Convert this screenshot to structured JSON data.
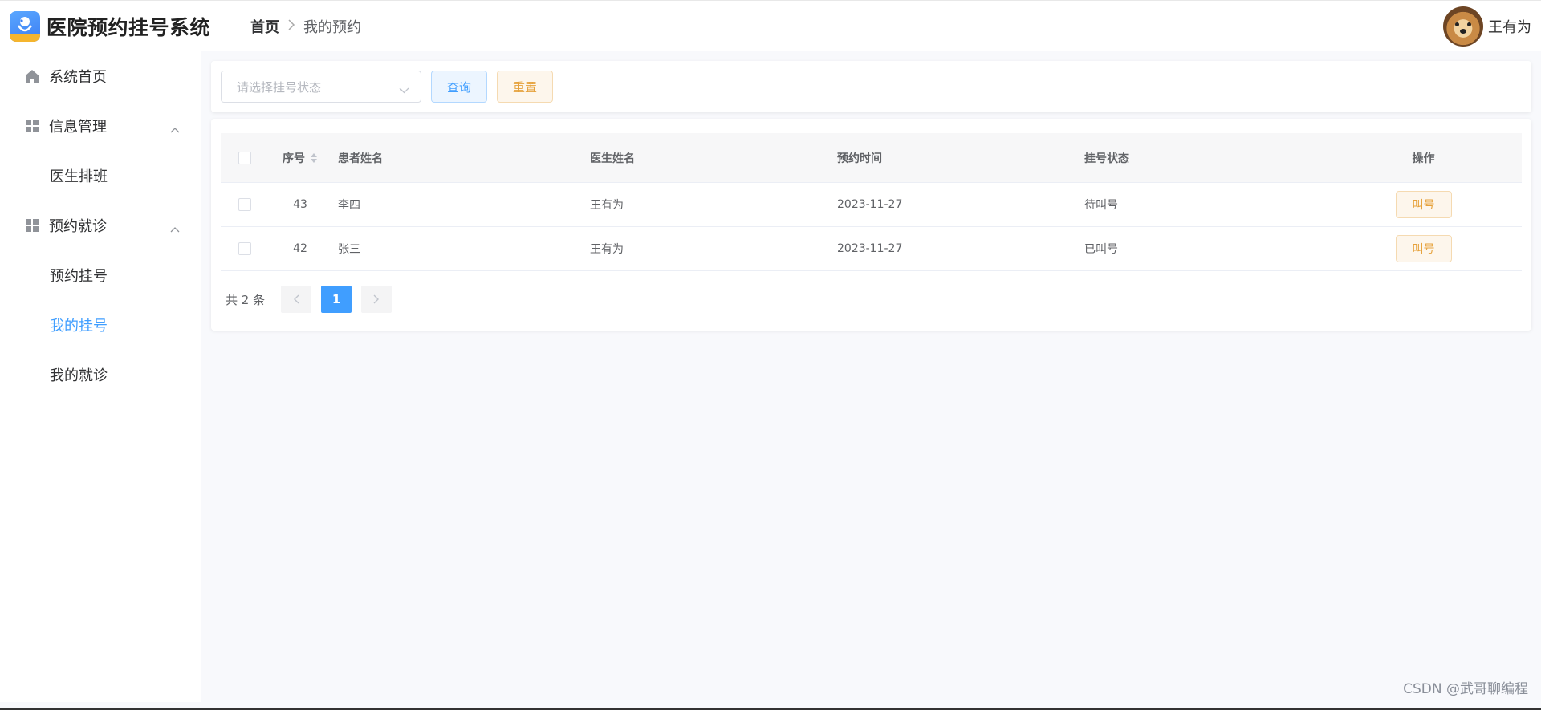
{
  "app": {
    "title": "医院预约挂号系统"
  },
  "breadcrumb": {
    "home": "首页",
    "current": "我的预约"
  },
  "user": {
    "name": "王有为"
  },
  "sidebar": {
    "items": [
      {
        "label": "系统首页",
        "icon": "home-icon"
      },
      {
        "label": "信息管理",
        "icon": "grid-icon",
        "expanded": true,
        "children": [
          "医生排班"
        ]
      },
      {
        "label": "预约就诊",
        "icon": "grid-icon",
        "expanded": true,
        "children": [
          "预约挂号",
          "我的挂号",
          "我的就诊"
        ]
      }
    ],
    "active": "我的挂号"
  },
  "filter": {
    "status_placeholder": "请选择挂号状态",
    "query_label": "查询",
    "reset_label": "重置"
  },
  "table": {
    "headers": {
      "index": "序号",
      "patient": "患者姓名",
      "doctor": "医生姓名",
      "time": "预约时间",
      "status": "挂号状态",
      "action": "操作"
    },
    "rows": [
      {
        "index": "43",
        "patient": "李四",
        "doctor": "王有为",
        "time": "2023-11-27",
        "status": "待叫号",
        "action": "叫号"
      },
      {
        "index": "42",
        "patient": "张三",
        "doctor": "王有为",
        "time": "2023-11-27",
        "status": "已叫号",
        "action": "叫号"
      }
    ]
  },
  "pagination": {
    "total_text": "共 2 条",
    "current_page": "1"
  },
  "watermark": "CSDN @武哥聊编程",
  "colors": {
    "primary": "#409eff",
    "warning": "#e6a23c"
  }
}
